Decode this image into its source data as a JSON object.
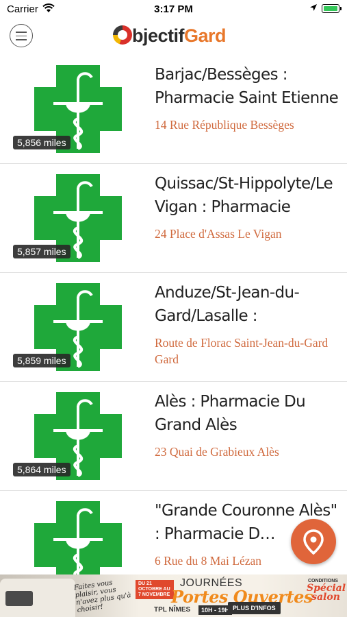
{
  "status_bar": {
    "carrier": "Carrier",
    "time": "3:17 PM"
  },
  "header": {
    "logo_part1": "bjectif",
    "logo_part2": "Gard",
    "logo_colors": {
      "dark": "#2b2b2b",
      "accent": "#e8772a"
    }
  },
  "list": {
    "items": [
      {
        "title": "Barjac/Bessèges : Pharmacie Saint Etienne",
        "address": "14 Rue République Bessèges",
        "distance": "5,856 miles"
      },
      {
        "title": "Quissac/St-Hippolyte/Le Vigan : Pharmacie Rom…",
        "address": "24 Place d'Assas Le Vigan",
        "distance": "5,857 miles"
      },
      {
        "title": "Anduze/St-Jean-du-Gard/Lasalle : Pharmaci…",
        "address": "Route de Florac Saint-Jean-du-Gard Gard",
        "distance": "5,859 miles"
      },
      {
        "title": "Alès : Pharmacie Du Grand Alès",
        "address": "23 Quai de Grabieux Alès",
        "distance": "5,864 miles"
      },
      {
        "title": "\"Grande Couronne Alès\" : Pharmacie D…",
        "address": "6 Rue du 8 Mai Lézan",
        "distance": ""
      }
    ]
  },
  "map_button": {
    "icon": "map-pin-icon",
    "color": "#e0653a"
  },
  "ad_banner": {
    "slogan": "Faites vous plaisir, vous n'avez plus qu'à choisir!",
    "dates": "DU 21 OCTOBRE AU 7 NOVEMBRE",
    "journees": "JOURNÉES",
    "portes": "Portes Ouvertes",
    "venue": "TPL NÎMES",
    "hours": "10H - 19H",
    "more": "PLUS D'INFOS",
    "conditions": "CONDITIONS",
    "special": "Spécial salon"
  },
  "colors": {
    "cross_green": "#1fa83a",
    "address_orange": "#d06a3e",
    "title_text": "#222222"
  }
}
